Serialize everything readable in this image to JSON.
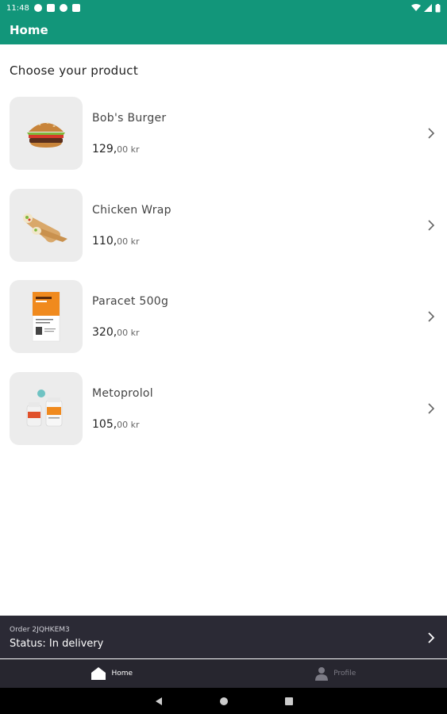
{
  "status_bar": {
    "time": "11:48",
    "icons": [
      "notification-a-icon",
      "notification-b-icon",
      "notification-c-icon",
      "sd-card-icon"
    ],
    "right_icons": [
      "wifi-icon",
      "signal-icon",
      "battery-icon"
    ]
  },
  "app_bar": {
    "title": "Home",
    "color": "#12967a"
  },
  "main": {
    "section_title": "Choose your product",
    "products": [
      {
        "name": "Bob's Burger",
        "price_main": "129,",
        "price_decimals": "00 kr",
        "image": "burger-image"
      },
      {
        "name": "Chicken Wrap",
        "price_main": "110,",
        "price_decimals": "00 kr",
        "image": "wrap-image"
      },
      {
        "name": "Paracet 500g",
        "price_main": "320,",
        "price_decimals": "00 kr",
        "image": "paracet-box-image"
      },
      {
        "name": "Metoprolol",
        "price_main": "105,",
        "price_decimals": "00 kr",
        "image": "pill-bottles-image"
      }
    ]
  },
  "order_bar": {
    "order_id": "Order 2JQHKEM3",
    "status": "Status: In delivery"
  },
  "bottom_nav": {
    "items": [
      {
        "label": "Home",
        "icon": "home-icon",
        "active": true
      },
      {
        "label": "Profile",
        "icon": "profile-icon",
        "active": false
      }
    ]
  },
  "system_nav": [
    "back-icon",
    "home-circle-icon",
    "recents-icon"
  ]
}
